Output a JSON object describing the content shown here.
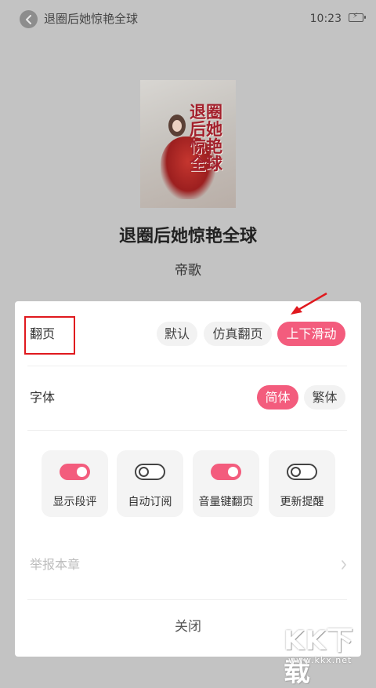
{
  "header": {
    "title": "退圈后她惊艳全球",
    "time": "10:23",
    "back_icon": "chevron-left-icon",
    "battery_icon": "battery-charging-icon"
  },
  "book": {
    "title": "退圈后她惊艳全球",
    "author": "帝歌",
    "cover_title": "退圈后她惊艳全球"
  },
  "settings": {
    "page_turn": {
      "label": "翻页",
      "options": [
        "默认",
        "仿真翻页",
        "上下滑动"
      ],
      "selected": "上下滑动"
    },
    "font": {
      "label": "字体",
      "options": [
        "简体",
        "繁体"
      ],
      "selected": "简体"
    },
    "toggles": [
      {
        "label": "显示段评",
        "on": true
      },
      {
        "label": "自动订阅",
        "on": false
      },
      {
        "label": "音量键翻页",
        "on": true
      },
      {
        "label": "更新提醒",
        "on": false
      }
    ],
    "report_label": "举报本章",
    "close_label": "关闭"
  },
  "watermark": {
    "text": "KK下载",
    "url": "www.kkx.net"
  },
  "colors": {
    "accent": "#f35c7d",
    "annotation": "#e0191e",
    "overlay_bg": "#c3c3c3"
  }
}
